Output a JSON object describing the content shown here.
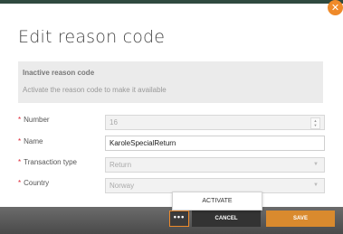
{
  "dialog": {
    "title": "Edit reason code",
    "close_icon": "close-icon"
  },
  "notice": {
    "title": "Inactive reason code",
    "text": "Activate the reason code to make it available"
  },
  "form": {
    "required_marker": "*",
    "number": {
      "label": "Number",
      "value": "16"
    },
    "name": {
      "label": "Name",
      "value": "KaroleSpecialReturn"
    },
    "transaction_type": {
      "label": "Transaction type",
      "value": "Return"
    },
    "country": {
      "label": "Country",
      "value": "Norway"
    }
  },
  "footer": {
    "more_label": "•••",
    "cancel_label": "CANCEL",
    "save_label": "SAVE",
    "menu": {
      "activate_label": "ACTIVATE"
    }
  },
  "colors": {
    "accent": "#ef8a2a",
    "save": "#d98a2e",
    "required": "#dd2233",
    "header": "#2f4a3f"
  }
}
